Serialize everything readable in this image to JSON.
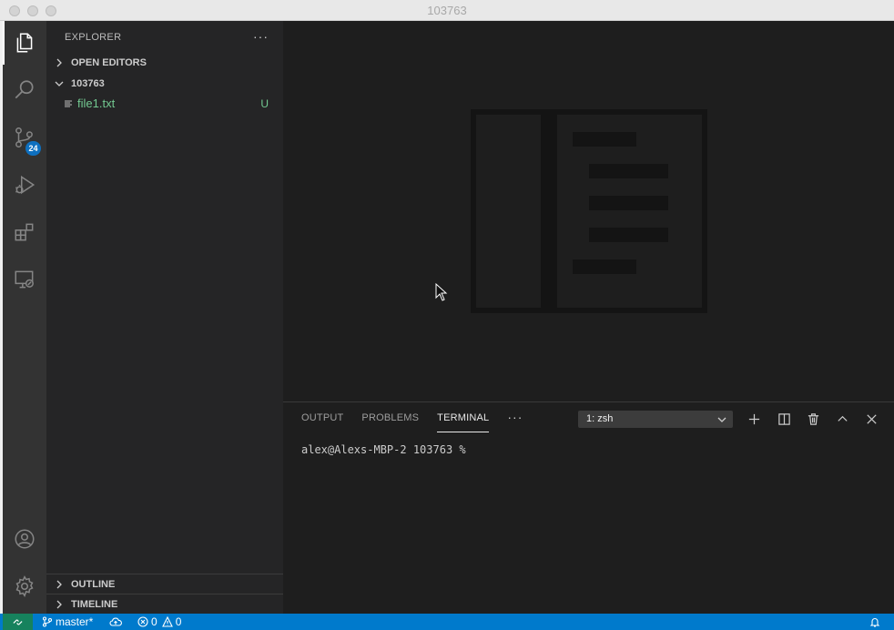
{
  "window": {
    "title": "103763"
  },
  "activity_bar": {
    "items": [
      {
        "name": "explorer",
        "icon": "files-icon",
        "active": true
      },
      {
        "name": "search",
        "icon": "search-icon"
      },
      {
        "name": "source-control",
        "icon": "source-control-icon",
        "badge": "24"
      },
      {
        "name": "run-debug",
        "icon": "run-debug-icon"
      },
      {
        "name": "extensions",
        "icon": "extensions-icon"
      },
      {
        "name": "remote-explorer",
        "icon": "remote-explorer-icon"
      }
    ],
    "bottom": [
      {
        "name": "accounts",
        "icon": "account-icon"
      },
      {
        "name": "manage",
        "icon": "gear-icon"
      }
    ]
  },
  "sidebar": {
    "title": "EXPLORER",
    "open_editors": "OPEN EDITORS",
    "folder": "103763",
    "files": [
      {
        "name": "file1.txt",
        "status": "U"
      }
    ],
    "outline": "OUTLINE",
    "timeline": "TIMELINE"
  },
  "panel": {
    "tabs": [
      {
        "label": "OUTPUT"
      },
      {
        "label": "PROBLEMS"
      },
      {
        "label": "TERMINAL",
        "active": true
      }
    ],
    "terminal_select": "1: zsh",
    "terminal_prompt": "alex@Alexs-MBP-2 103763 %"
  },
  "status_bar": {
    "branch": "master*",
    "errors": "0",
    "warnings": "0"
  },
  "colors": {
    "accent": "#007acc",
    "remote": "#16825d",
    "untracked": "#73c991",
    "badge": "#0e70c0"
  }
}
